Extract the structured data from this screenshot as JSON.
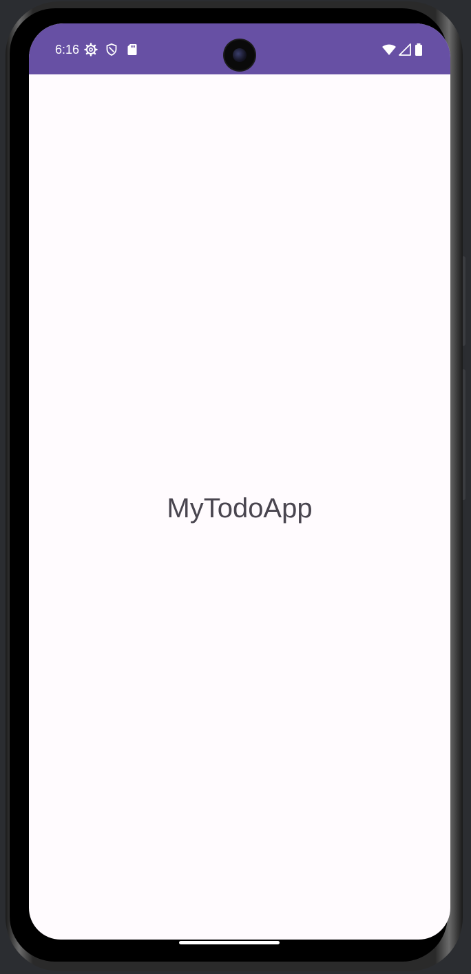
{
  "status_bar": {
    "time": "6:16",
    "icons": [
      "settings-gear-icon",
      "shield-icon",
      "sd-card-icon",
      "wifi-icon",
      "cellular-signal-icon",
      "battery-icon"
    ],
    "background_color": "#6750a4"
  },
  "app": {
    "title": "MyTodoApp",
    "background_color": "#fffbfe",
    "title_color": "#49454f"
  }
}
